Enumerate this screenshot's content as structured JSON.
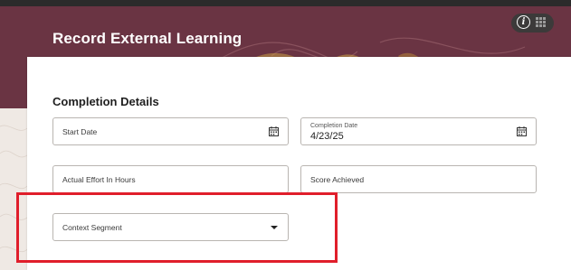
{
  "header": {
    "title": "Record External Learning"
  },
  "toolbar": {
    "info_icon_glyph": "i",
    "icons": [
      "info-icon",
      "apps-grid-icon"
    ]
  },
  "form": {
    "section_title": "Completion Details",
    "fields": {
      "start_date": {
        "label": "Start Date",
        "value": "",
        "icon": "calendar-icon"
      },
      "completion_date": {
        "label": "Completion Date",
        "value": "4/23/25",
        "icon": "calendar-icon"
      },
      "actual_effort": {
        "label": "Actual Effort In Hours",
        "value": ""
      },
      "score_achieved": {
        "label": "Score Achieved",
        "value": ""
      },
      "context_segment": {
        "label": "Context Segment",
        "value": "",
        "icon": "chevron-down-icon"
      }
    }
  },
  "colors": {
    "banner": "#6a3443",
    "highlight_box": "#e01e2b",
    "topbar": "#2b2b2b"
  }
}
